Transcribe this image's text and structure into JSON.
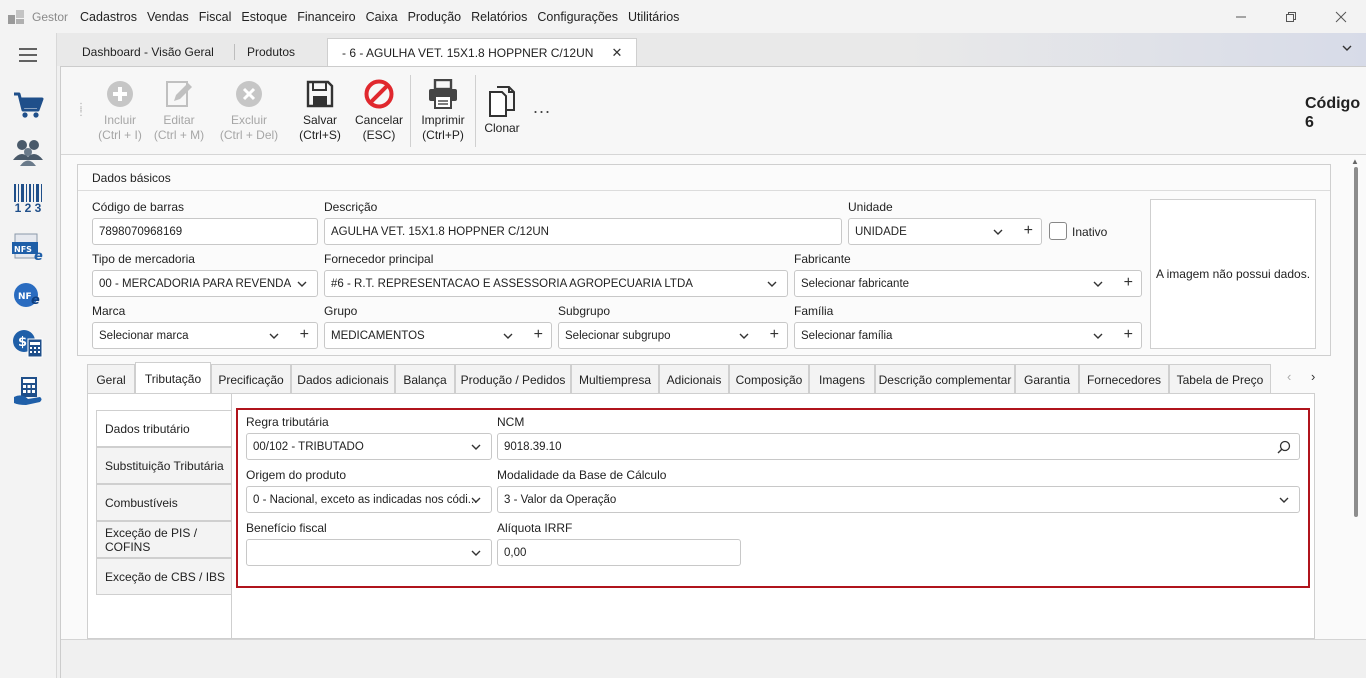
{
  "app": {
    "name": "Gestor",
    "menu": [
      "Cadastros",
      "Vendas",
      "Fiscal",
      "Estoque",
      "Financeiro",
      "Caixa",
      "Produção",
      "Relatórios",
      "Configurações",
      "Utilitários"
    ]
  },
  "sidebar": {
    "icons": [
      "menu-icon",
      "cart-icon",
      "users-icon",
      "barcode-icon",
      "nfse-icon",
      "nfe-icon",
      "cash-register-icon",
      "calculator-icon"
    ],
    "barcode_digits": "1 2 3",
    "nfse_text": "NFS",
    "nfe_text": "NF"
  },
  "doc_tabs": [
    {
      "label": "Dashboard - Visão Geral"
    },
    {
      "label": "Produtos"
    },
    {
      "label": "- 6 - AGULHA VET. 15X1.8 HOPPNER C/12UN"
    }
  ],
  "toolbar": {
    "incluir": "Incluir",
    "incluir_sc": "(Ctrl + I)",
    "editar": "Editar",
    "editar_sc": "(Ctrl + M)",
    "excluir": "Excluir",
    "excluir_sc": "(Ctrl + Del)",
    "salvar": "Salvar",
    "salvar_sc": "(Ctrl+S)",
    "cancelar": "Cancelar",
    "cancelar_sc": "(ESC)",
    "imprimir": "Imprimir",
    "imprimir_sc": "(Ctrl+P)",
    "clonar": "Clonar",
    "more": "...",
    "codigo_label": "Código",
    "codigo_value": "6"
  },
  "dados_basicos": {
    "title": "Dados básicos",
    "codigo_barras_label": "Código de barras",
    "codigo_barras": "7898070968169",
    "descricao_label": "Descrição",
    "descricao": "AGULHA VET. 15X1.8 HOPPNER C/12UN",
    "unidade_label": "Unidade",
    "unidade": "UNIDADE",
    "inativo_label": "Inativo",
    "tipo_label": "Tipo de mercadoria",
    "tipo": "00 - MERCADORIA PARA REVENDA",
    "fornecedor_label": "Fornecedor principal",
    "fornecedor": "#6 - R.T. REPRESENTACAO E ASSESSORIA AGROPECUARIA LTDA",
    "fabricante_label": "Fabricante",
    "fabricante": "Selecionar fabricante",
    "marca_label": "Marca",
    "marca": "Selecionar marca",
    "grupo_label": "Grupo",
    "grupo": "MEDICAMENTOS",
    "subgrupo_label": "Subgrupo",
    "subgrupo": "Selecionar subgrupo",
    "familia_label": "Família",
    "familia": "Selecionar família",
    "imagem_msg": "A imagem não possui dados."
  },
  "tabs": [
    "Geral",
    "Tributação",
    "Precificação",
    "Dados adicionais",
    "Balança",
    "Produção / Pedidos",
    "Multiempresa",
    "Adicionais",
    "Composição",
    "Imagens",
    "Descrição complementar",
    "Garantia",
    "Fornecedores",
    "Tabela de Preço"
  ],
  "vtabs": [
    "Dados tributário",
    "Substituição Tributária",
    "Combustíveis",
    "Exceção de PIS / COFINS",
    "Exceção de CBS / IBS"
  ],
  "tributacao": {
    "regra_label": "Regra tributária",
    "regra": "00/102 - TRIBUTADO",
    "ncm_label": "NCM",
    "ncm": "9018.39.10",
    "origem_label": "Origem do produto",
    "origem": "0 - Nacional, exceto as indicadas nos códi...",
    "modalidade_label": "Modalidade da Base de Cálculo",
    "modalidade": "3 - Valor da Operação",
    "beneficio_label": "Benefício fiscal",
    "beneficio": "",
    "aliquota_label": "Alíquota IRRF",
    "aliquota": "0,00"
  }
}
